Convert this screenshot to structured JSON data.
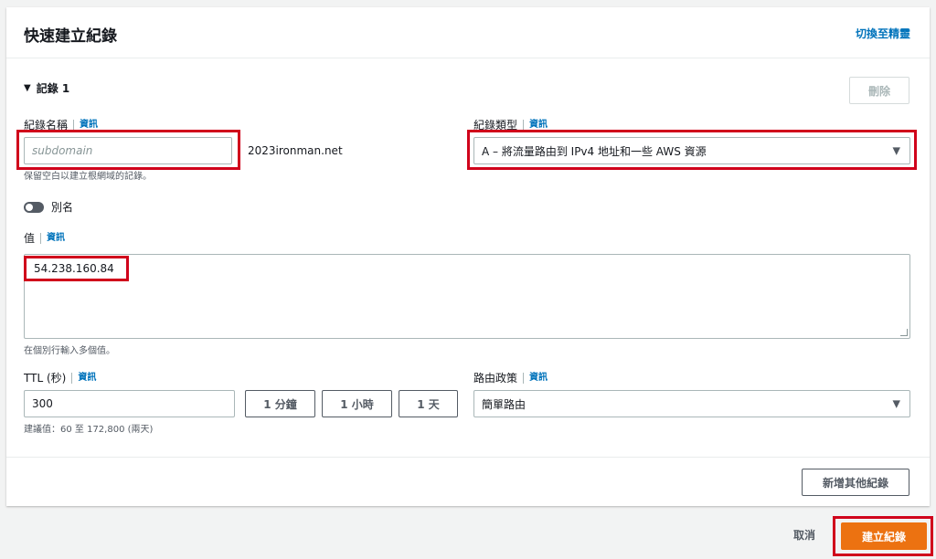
{
  "header": {
    "title": "快速建立紀錄",
    "switch_link": "切換至精靈"
  },
  "record": {
    "section_label": "記錄 1",
    "delete_label": "刪除",
    "name": {
      "label": "紀錄名稱",
      "info": "資訊",
      "placeholder": "subdomain",
      "domain_suffix": "2023ironman.net",
      "hint": "保留空白以建立根網域的記錄。"
    },
    "type": {
      "label": "紀錄類型",
      "info": "資訊",
      "selected": "A – 將流量路由到 IPv4 地址和一些 AWS 資源"
    },
    "alias": {
      "label": "別名",
      "enabled": false
    },
    "value": {
      "label": "值",
      "info": "資訊",
      "text": "54.238.160.84",
      "hint": "在個別行輸入多個值。"
    },
    "ttl": {
      "label": "TTL (秒)",
      "info": "資訊",
      "value": "300",
      "presets": [
        "1 分鐘",
        "1 小時",
        "1 天"
      ],
      "hint": "建議值：60 至 172,800 (兩天)"
    },
    "routing": {
      "label": "路由政策",
      "info": "資訊",
      "selected": "簡單路由"
    }
  },
  "add_record_label": "新增其他紀錄",
  "footer": {
    "cancel_label": "取消",
    "create_label": "建立紀錄"
  },
  "colors": {
    "primary": "#ec7211",
    "link": "#0073bb",
    "highlight": "#d0021b"
  }
}
